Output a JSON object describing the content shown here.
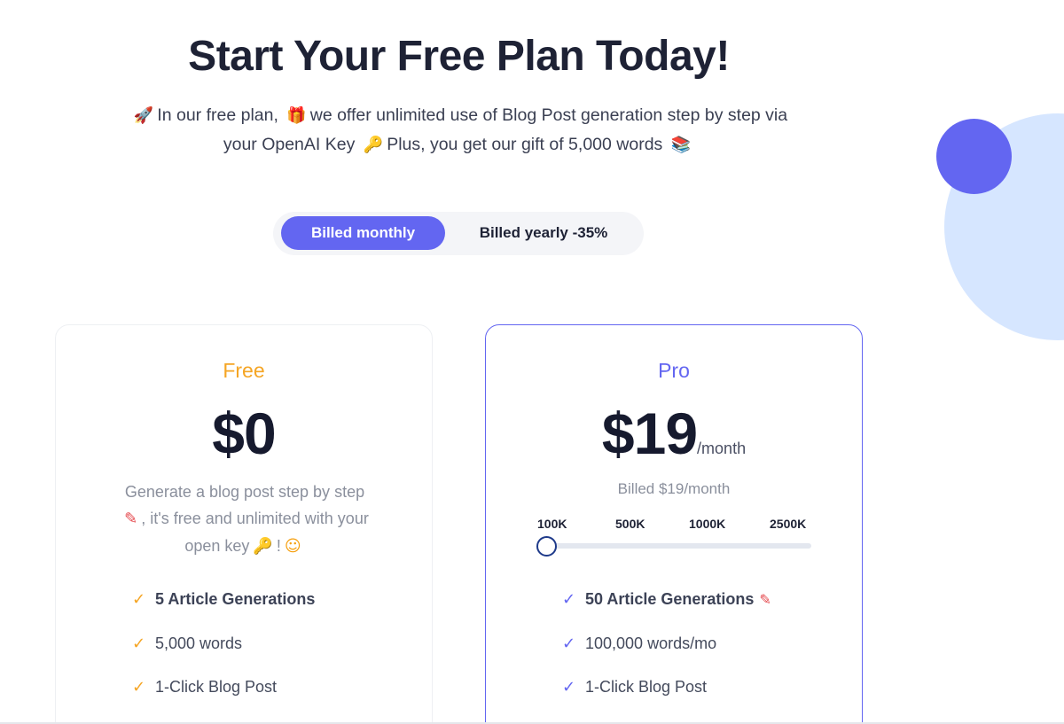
{
  "hero": {
    "title": "Start Your Free Plan Today!",
    "line1_a": "In our free plan,",
    "line1_b": "we offer unlimited use of Blog Post generation step by step via",
    "line2_a": "your OpenAI Key",
    "line2_b": "Plus, you get our gift of 5,000 words",
    "icons": {
      "rocket": "🚀",
      "gift": "🎁",
      "key": "🔑",
      "books": "📚"
    }
  },
  "billing": {
    "monthly_label": "Billed monthly",
    "yearly_label": "Billed yearly -35%",
    "selected": "monthly"
  },
  "plans": {
    "free": {
      "name": "Free",
      "price": "$0",
      "desc_1": "Generate a blog post step by",
      "desc_2": "step",
      "desc_3": ", it's free and unlimited",
      "desc_4": "with your open key",
      "desc_5": "!",
      "features": [
        "5 Article Generations",
        "5,000 words",
        "1-Click Blog Post"
      ]
    },
    "pro": {
      "name": "Pro",
      "price": "$19",
      "period": "/month",
      "billed_note": "Billed $19/month",
      "slider_ticks": [
        "100K",
        "500K",
        "1000K",
        "2500K"
      ],
      "slider_selected": "100K",
      "features": [
        "50 Article Generations",
        "100,000 words/mo",
        "1-Click Blog Post"
      ]
    }
  },
  "colors": {
    "accent": "#6366f1",
    "free_accent": "#f5a524",
    "deco_light": "#d6e6ff"
  }
}
